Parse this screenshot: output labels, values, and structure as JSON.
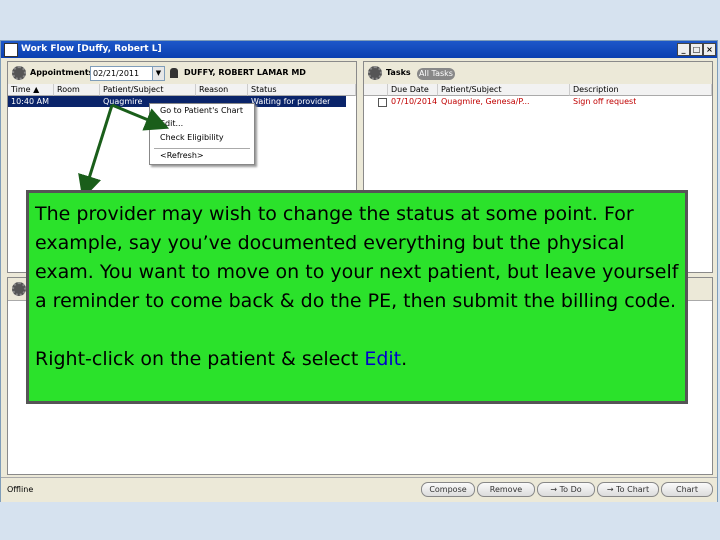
{
  "window": {
    "title": "Work Flow [Duffy, Robert L]"
  },
  "appointments": {
    "label": "Appointments",
    "date": "02/21/2011",
    "provider": "DUFFY, ROBERT LAMAR MD",
    "columns": [
      "Time",
      "Room",
      "Patient/Subject",
      "Reason",
      "Status"
    ],
    "row": {
      "time": "10:40 AM",
      "patient": "Quagmire",
      "reason": "",
      "status": "Waiting for provider"
    }
  },
  "context_menu": {
    "items": [
      "Go to Patient's Chart",
      "Edit...",
      "Check Eligibility",
      "<Refresh>"
    ]
  },
  "tasks": {
    "label": "Tasks",
    "filter": "All Tasks",
    "columns": [
      "Due Date",
      "Patient/Subject",
      "Description"
    ],
    "row": {
      "due_date": "07/10/2014",
      "patient": "Quagmire, Genesa/P...",
      "description": "Sign off request"
    }
  },
  "statusbar": {
    "status": "Offline",
    "buttons": [
      "Compose",
      "Remove",
      "→ To Do",
      "→ To Chart",
      "Chart"
    ]
  },
  "callout": {
    "paragraph1": "The provider may wish to change the status at some point. For example, say you’ve documented everything but the physical exam. You want to move on to your next patient, but leave yourself a reminder to come back & do the PE, then submit the billing code.",
    "paragraph2_prefix": "Right-click on the patient & select ",
    "paragraph2_link": "Edit",
    "paragraph2_suffix": "."
  },
  "colors": {
    "callout_bg": "#2be22b",
    "selection": "#0a246a",
    "task_text": "#c00000"
  }
}
